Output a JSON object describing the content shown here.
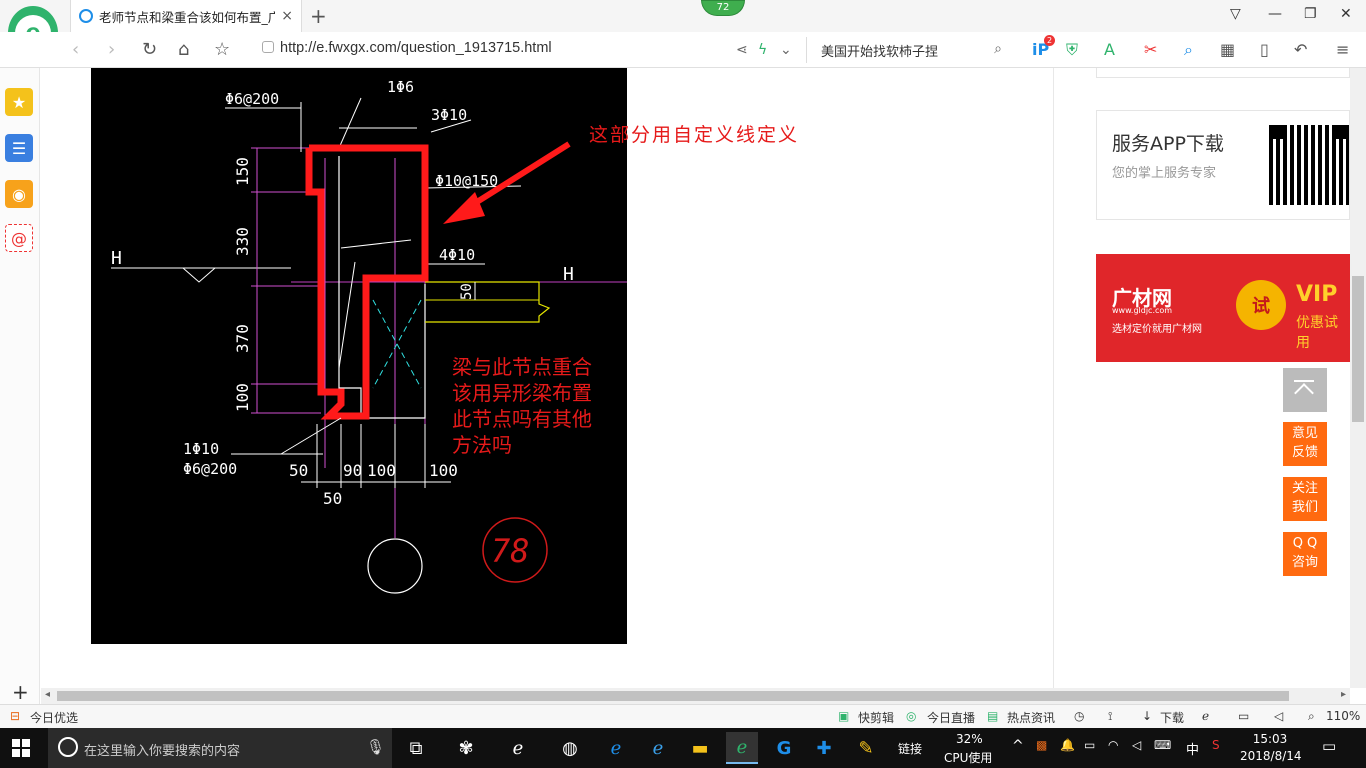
{
  "browser": {
    "tab_title": "老师节点和梁重合该如何布置_广",
    "tab_close": "×",
    "new_tab": "+",
    "badge_count": "72",
    "url": "http://e.fwxgx.com/question_1913715.html",
    "search_text": "美国开始找软柿子捏",
    "toolbar_badge": "2",
    "icons": [
      "back-icon",
      "forward-icon",
      "refresh-icon",
      "home-icon",
      "star-icon",
      "share-icon",
      "bolt-icon",
      "shield-icon",
      "translate-icon",
      "scissors-icon",
      "search-icon",
      "apps-icon",
      "phone-icon",
      "undo-icon",
      "menu-icon"
    ]
  },
  "sidebar": {
    "items": [
      "favorites-icon",
      "reader-icon",
      "weibo-icon",
      "mail-icon"
    ],
    "plus": "+"
  },
  "drawing": {
    "labels": {
      "top_rebar": "1Φ6",
      "stirrup_top": "Φ6@200",
      "rebar_3": "3Φ10",
      "stirrup_right": "Φ10@150",
      "rebar_4": "4Φ10",
      "dim_150": "150",
      "dim_330": "330",
      "dim_370": "370",
      "dim_100v": "100",
      "dim_50v": "50",
      "bottom_rebar": "1Φ10",
      "stirrup_bottom": "Φ6@200",
      "dim_50a": "50",
      "dim_90": "90",
      "dim_100a": "100",
      "dim_100b": "100",
      "dim_50b": "50",
      "level_left": "H",
      "level_right": "H",
      "axis_num": "78"
    },
    "annotation_top": "这部分用自定义线定义",
    "annotation_bottom": [
      "梁与此节点重合",
      "该用异形梁布置",
      "此节点吗有其他",
      "方法吗"
    ]
  },
  "right_panel": {
    "app_title": "服务APP下载",
    "app_subtitle": "您的掌上服务专家",
    "ad": {
      "brand": "广材网",
      "brand_url": "www.gldjc.com",
      "slogan": "选材定价就用广材网",
      "try": "试",
      "vip": "VIP",
      "vip_sub": "优惠试用"
    },
    "float_buttons": [
      "意见\n反馈",
      "关注\n我们",
      "Q Q\n咨询"
    ]
  },
  "statusbar": {
    "left": "今日优选",
    "items": [
      "快剪辑",
      "今日直播",
      "热点资讯",
      "下载"
    ],
    "zoom": "110%"
  },
  "taskbar": {
    "search_placeholder": "在这里输入你要搜索的内容",
    "link_label": "链接",
    "cpu_percent": "32%",
    "cpu_label": "CPU使用",
    "ime": "中",
    "time": "15:03",
    "date": "2018/8/14"
  },
  "colors": {
    "accent_orange": "#ff6a10",
    "annotation_red": "#e61a1a",
    "cad_background": "#000000"
  }
}
